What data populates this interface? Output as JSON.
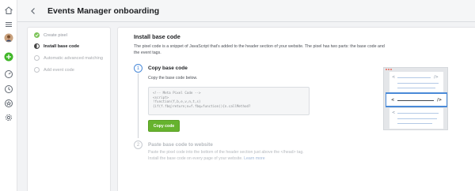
{
  "header": {
    "title": "Events Manager onboarding"
  },
  "rail": {
    "icons": [
      "home-icon",
      "menu-icon",
      "avatar",
      "create-icon",
      "dashboard-icon",
      "clock-icon",
      "star-icon",
      "settings-icon"
    ]
  },
  "steps": [
    {
      "label": "Create pixel",
      "state": "done"
    },
    {
      "label": "Install base code",
      "state": "active"
    },
    {
      "label": "Automatic advanced matching",
      "state": "todo"
    },
    {
      "label": "Add event code",
      "state": "todo"
    }
  ],
  "main": {
    "title": "Install base code",
    "description": "The pixel code is a snippet of JavaScript that's added to the header section of your website. The pixel has two parts: the base code and the event tags.",
    "step1": {
      "number": "1",
      "title": "Copy base code",
      "description": "Copy the base code below.",
      "code_lines": [
        "<!-- Meta Pixel Code -->",
        "<script>",
        "!function(f,b,e,v,n,t,s)",
        "{if(f.fbq)return;n=f.fbq=function(){n.callMethod?"
      ],
      "copy_label": "Copy code"
    },
    "step2": {
      "number": "2",
      "title": "Paste base code to website",
      "description": "Paste the pixel code into the bottom of the header section just above the </head> tag. Install the base code on every page of your website.",
      "link": "Learn more"
    }
  },
  "illustration": {
    "bracket_left": "<",
    "bracket_right": "/>"
  },
  "colors": {
    "accent": "#4a8ad8",
    "success": "#66b32e",
    "done": "#7ec45b"
  }
}
